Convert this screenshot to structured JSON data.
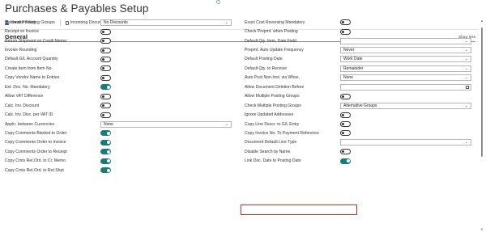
{
  "page": {
    "title": "Purchases & Payables Setup"
  },
  "actions": [
    {
      "label": "Vendor Posting Groups",
      "icon": "person-icon"
    },
    {
      "label": "Incoming Documents Setup",
      "icon": "document-icon"
    }
  ],
  "section": {
    "title": "General",
    "toggle_label": "Show less"
  },
  "left_fields": [
    {
      "label": "Discount Posting",
      "kind": "select",
      "value": "No Discounts"
    },
    {
      "label": "Receipt on Invoice",
      "kind": "toggle",
      "on": false
    },
    {
      "label": "Return Shipment on Credit Memo",
      "kind": "toggle",
      "on": false
    },
    {
      "label": "Invoice Rounding",
      "kind": "toggle",
      "on": false
    },
    {
      "label": "Default G/L Account Quantity",
      "kind": "toggle",
      "on": false
    },
    {
      "label": "Create Item from Item No.",
      "kind": "toggle",
      "on": false
    },
    {
      "label": "Copy Vendor Name to Entries",
      "kind": "toggle",
      "on": false
    },
    {
      "label": "Ext. Doc. No. Mandatory",
      "kind": "toggle",
      "on": true
    },
    {
      "label": "Allow VAT Difference",
      "kind": "toggle",
      "on": false
    },
    {
      "label": "Calc. Inv. Discount",
      "kind": "toggle",
      "on": false
    },
    {
      "label": "Calc. Inv. Disc. per VAT ID",
      "kind": "toggle",
      "on": false
    },
    {
      "label": "Appln. between Currencies",
      "kind": "select",
      "value": "None"
    },
    {
      "label": "Copy Comments Blanket to Order",
      "kind": "toggle",
      "on": true
    },
    {
      "label": "Copy Comments Order to Invoice",
      "kind": "toggle",
      "on": true
    },
    {
      "label": "Copy Comments Order to Receipt",
      "kind": "toggle",
      "on": true
    },
    {
      "label": "Copy Cmts Ret.Ord. to Cr. Memo",
      "kind": "toggle",
      "on": true
    },
    {
      "label": "Copy Cmts Ret.Ord. to Ret.Shpt",
      "kind": "toggle",
      "on": true
    }
  ],
  "right_fields": [
    {
      "label": "Exact Cost Reversing Mandatory",
      "kind": "toggle",
      "on": false
    },
    {
      "label": "Check Prepmt. when Posting",
      "kind": "toggle",
      "on": false
    },
    {
      "label": "Default Qty. Item, Date Field",
      "kind": "select",
      "value": ""
    },
    {
      "label": "Prepmt. Auto Update Frequency",
      "kind": "select",
      "value": "Never"
    },
    {
      "label": "Default Posting Date",
      "kind": "select",
      "value": "Work Date"
    },
    {
      "label": "Default Qty. to Receive",
      "kind": "select",
      "value": "Remainder"
    },
    {
      "label": "Auto Post Non-Invt. via Whse.",
      "kind": "select",
      "value": "None"
    },
    {
      "label": "Allow Document Deletion Before",
      "kind": "date",
      "value": ""
    },
    {
      "label": "Allow Multiple Posting Groups",
      "kind": "toggle",
      "on": false
    },
    {
      "label": "Check Multiple Posting Groups",
      "kind": "select",
      "value": "Alternative Groups"
    },
    {
      "label": "Ignore Updated Addresses",
      "kind": "toggle",
      "on": false
    },
    {
      "label": "Copy Line Descr. to G/L Entry",
      "kind": "toggle",
      "on": false
    },
    {
      "label": "Copy Invoice No. To Payment Reference",
      "kind": "toggle",
      "on": false
    },
    {
      "label": "Document Default Line Type",
      "kind": "select",
      "value": ""
    },
    {
      "label": "Disable Search by Name",
      "kind": "toggle",
      "on": false
    },
    {
      "label": "Link Doc. Date to Posting Date",
      "kind": "toggle",
      "on": true,
      "highlighted": true
    }
  ],
  "colors": {
    "accent": "#1a7a76",
    "highlight": "#d42a2a"
  }
}
